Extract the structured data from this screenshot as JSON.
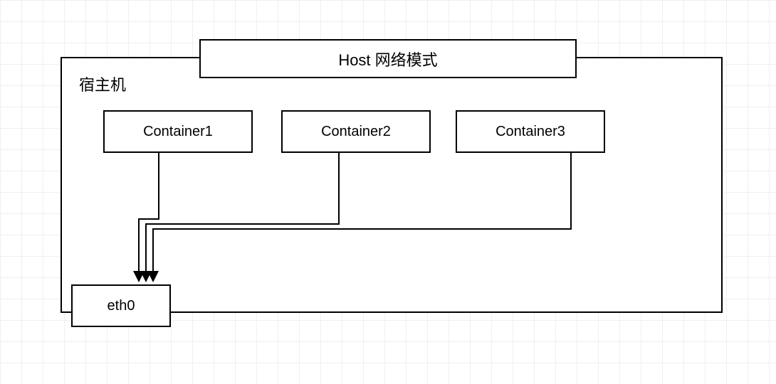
{
  "diagram": {
    "title": "Host 网络模式",
    "host_label": "宿主机",
    "containers": [
      {
        "label": "Container1"
      },
      {
        "label": "Container2"
      },
      {
        "label": "Container3"
      }
    ],
    "interface": "eth0"
  }
}
